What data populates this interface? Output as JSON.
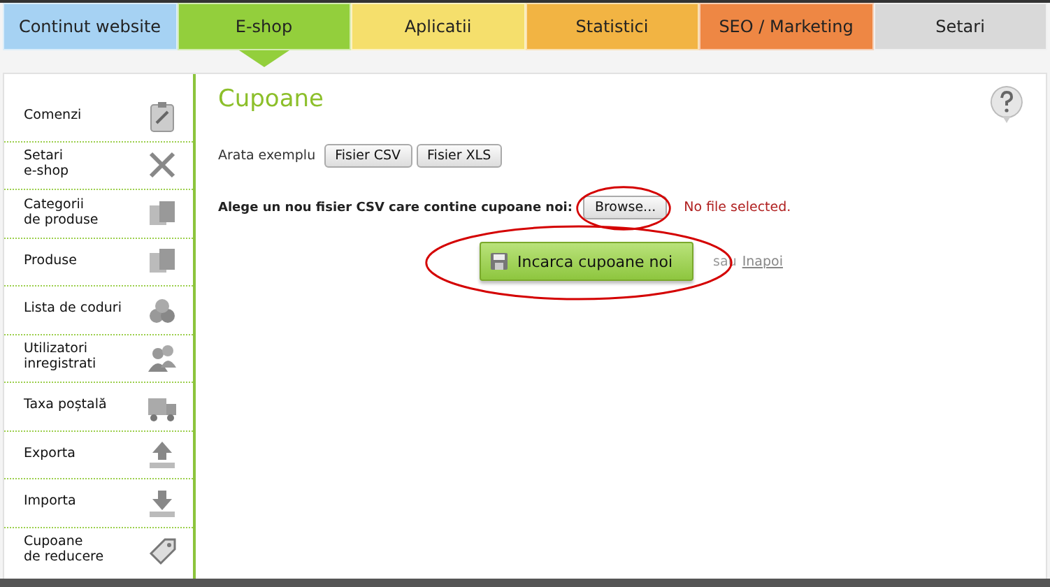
{
  "tabs": [
    {
      "label": "Continut website",
      "selected": false
    },
    {
      "label": "E-shop",
      "selected": true
    },
    {
      "label": "Aplicatii",
      "selected": false
    },
    {
      "label": "Statistici",
      "selected": false
    },
    {
      "label": "SEO / Marketing",
      "selected": false
    },
    {
      "label": "Setari",
      "selected": false
    }
  ],
  "sidebar": {
    "items": [
      {
        "label": "Comenzi"
      },
      {
        "label": "Setari\ne-shop"
      },
      {
        "label": "Categorii\nde produse"
      },
      {
        "label": "Produse"
      },
      {
        "label": "Lista de coduri"
      },
      {
        "label": "Utilizatori\ninregistrati"
      },
      {
        "label": "Taxa poștală"
      },
      {
        "label": "Exporta"
      },
      {
        "label": "Importa"
      },
      {
        "label": "Cupoane\nde reducere"
      }
    ]
  },
  "page": {
    "title": "Cupoane",
    "example_label": "Arata exemplu",
    "example_buttons": [
      "Fisier CSV",
      "Fisier XLS"
    ],
    "file_label": "Alege un nou fisier CSV care contine cupoane noi:",
    "browse_button": {
      "label": "Browse...",
      "highlighted": true
    },
    "file_status": "No file selected.",
    "submit_button": {
      "label": "Incarca cupoane noi",
      "highlighted": true
    },
    "or_text": "sau",
    "back_link": "Inapoi"
  }
}
